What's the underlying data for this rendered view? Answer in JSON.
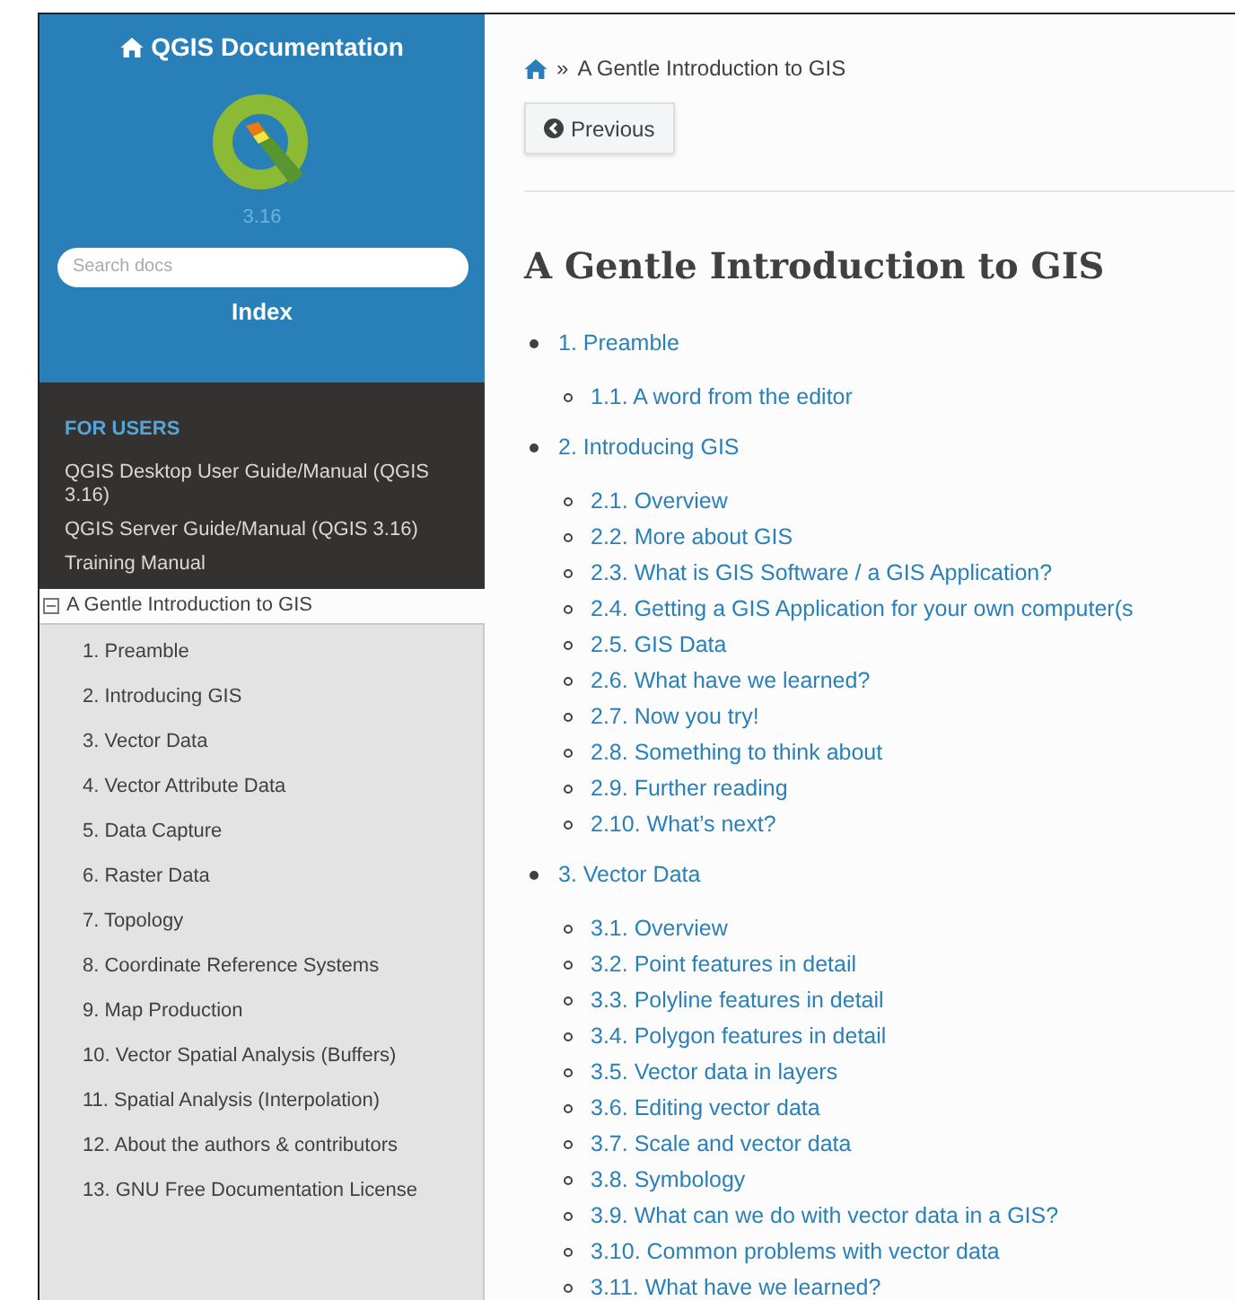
{
  "sidebar": {
    "title": "QGIS Documentation",
    "version": "3.16",
    "search": {
      "placeholder": "Search docs"
    },
    "index_link": "Index",
    "caption": "FOR USERS",
    "items": [
      {
        "label": "QGIS Desktop User Guide/Manual (QGIS 3.16)"
      },
      {
        "label": "QGIS Server Guide/Manual (QGIS 3.16)"
      },
      {
        "label": "Training Manual"
      }
    ],
    "current": {
      "label": "A Gentle Introduction to GIS",
      "expanded": true,
      "children": [
        {
          "label": "1. Preamble"
        },
        {
          "label": "2. Introducing GIS"
        },
        {
          "label": "3. Vector Data"
        },
        {
          "label": "4. Vector Attribute Data"
        },
        {
          "label": "5. Data Capture"
        },
        {
          "label": "6. Raster Data"
        },
        {
          "label": "7. Topology"
        },
        {
          "label": "8. Coordinate Reference Systems"
        },
        {
          "label": "9. Map Production"
        },
        {
          "label": "10. Vector Spatial Analysis (Buffers)"
        },
        {
          "label": "11. Spatial Analysis (Interpolation)"
        },
        {
          "label": "12. About the authors & contributors"
        },
        {
          "label": "13. GNU Free Documentation License"
        }
      ]
    }
  },
  "content": {
    "breadcrumb": {
      "separator": "»",
      "label": "A Gentle Introduction to GIS"
    },
    "previous_button": "Previous",
    "heading": "A Gentle Introduction to GIS",
    "toc": [
      {
        "label": "1. Preamble",
        "children": [
          {
            "label": "1.1. A word from the editor"
          }
        ]
      },
      {
        "label": "2. Introducing GIS",
        "children": [
          {
            "label": "2.1. Overview"
          },
          {
            "label": "2.2. More about GIS"
          },
          {
            "label": "2.3. What is GIS Software / a GIS Application?"
          },
          {
            "label": "2.4. Getting a GIS Application for your own computer(s"
          },
          {
            "label": "2.5. GIS Data"
          },
          {
            "label": "2.6. What have we learned?"
          },
          {
            "label": "2.7. Now you try!"
          },
          {
            "label": "2.8. Something to think about"
          },
          {
            "label": "2.9. Further reading"
          },
          {
            "label": "2.10. What’s next?"
          }
        ]
      },
      {
        "label": "3. Vector Data",
        "children": [
          {
            "label": "3.1. Overview"
          },
          {
            "label": "3.2. Point features in detail"
          },
          {
            "label": "3.3. Polyline features in detail"
          },
          {
            "label": "3.4. Polygon features in detail"
          },
          {
            "label": "3.5. Vector data in layers"
          },
          {
            "label": "3.6. Editing vector data"
          },
          {
            "label": "3.7. Scale and vector data"
          },
          {
            "label": "3.8. Symbology"
          },
          {
            "label": "3.9. What can we do with vector data in a GIS?"
          },
          {
            "label": "3.10. Common problems with vector data"
          },
          {
            "label": "3.11. What have we learned?"
          }
        ]
      }
    ]
  }
}
